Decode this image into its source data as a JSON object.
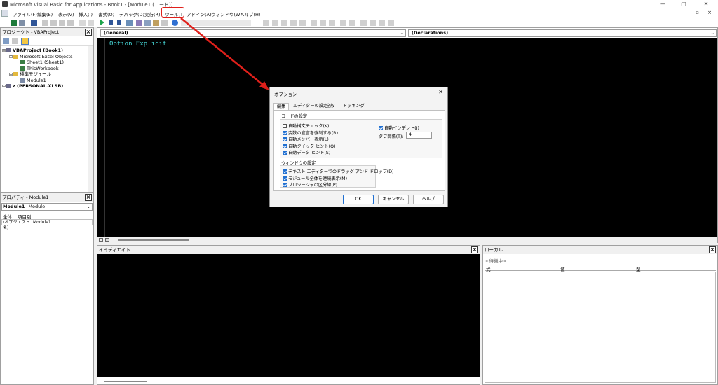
{
  "window": {
    "title": "Microsoft Visual Basic for Applications - Book1 - [Module1 (コード)]",
    "controls": [
      "—",
      "▢",
      "✕"
    ]
  },
  "menubar": {
    "items": [
      "ファイル(F)",
      "編集(E)",
      "表示(V)",
      "挿入(I)",
      "書式(O)",
      "デバッグ(D)",
      "実行(R)",
      "ツール(T)",
      "アドイン(A)",
      "ウィンドウ(W)",
      "ヘルプ(H)"
    ],
    "mdi_controls": "_ ▫ ×"
  },
  "project": {
    "title": "プロジェクト - VBAProject",
    "tree": [
      {
        "label": "VBAProject (Book1)",
        "bold": true,
        "indent": 0,
        "icon": "vba-project-icon"
      },
      {
        "label": "Microsoft Excel Objects",
        "bold": false,
        "indent": 1,
        "icon": "folder-icon"
      },
      {
        "label": "Sheet1 (Sheet1)",
        "bold": false,
        "indent": 2,
        "icon": "sheet-icon"
      },
      {
        "label": "ThisWorkbook",
        "bold": false,
        "indent": 2,
        "icon": "workbook-icon"
      },
      {
        "label": "標準モジュール",
        "bold": false,
        "indent": 1,
        "icon": "folder-icon"
      },
      {
        "label": "Module1",
        "bold": false,
        "indent": 2,
        "icon": "module-icon"
      },
      {
        "label": "z (PERSONAL.XLSB)",
        "bold": true,
        "indent": 0,
        "icon": "vba-project-icon"
      }
    ]
  },
  "properties": {
    "title": "プロパティ - Module1",
    "object": "Module1",
    "object_type": "Module",
    "tabs": [
      "全体",
      "項目別"
    ],
    "rows": [
      {
        "name": "(オブジェクト名)",
        "value": "Module1"
      }
    ]
  },
  "code": {
    "object_combo": "(General)",
    "proc_combo": "(Declarations)",
    "text": "Option Explicit"
  },
  "immediate": {
    "title": "イミディエイト"
  },
  "locals": {
    "title": "ローカル",
    "status": "<待機中>",
    "columns": [
      "式",
      "値",
      "型"
    ]
  },
  "dialog": {
    "title": "オプション",
    "tabs": [
      "編集",
      "エディターの設定",
      "全般",
      "ドッキング"
    ],
    "code_group": "コードの設定",
    "code_options": [
      {
        "label": "自動構文チェック(K)",
        "checked": false
      },
      {
        "label": "変数の宣言を強制する(R)",
        "checked": true
      },
      {
        "label": "自動メンバー表示(L)",
        "checked": true
      },
      {
        "label": "自動クイック ヒント(Q)",
        "checked": true
      },
      {
        "label": "自動データ ヒント(S)",
        "checked": true
      }
    ],
    "auto_indent": {
      "label": "自動インデント(I)",
      "checked": true
    },
    "tab_width_label": "タブ間隔(T):",
    "tab_width": "4",
    "window_group": "ウィンドウの設定",
    "window_options": [
      {
        "label": "テキスト エディターでのドラッグ アンド ドロップ(D)",
        "checked": true
      },
      {
        "label": "モジュール全体を連続表示(M)",
        "checked": true
      },
      {
        "label": "プロシージャの区分線(P)",
        "checked": true
      }
    ],
    "buttons": {
      "ok": "OK",
      "cancel": "キャンセル",
      "help": "ヘルプ"
    }
  },
  "colors": {
    "accent": "#e0201b",
    "code_text": "#46d6d6",
    "checkbox": "#1f6fd1"
  }
}
